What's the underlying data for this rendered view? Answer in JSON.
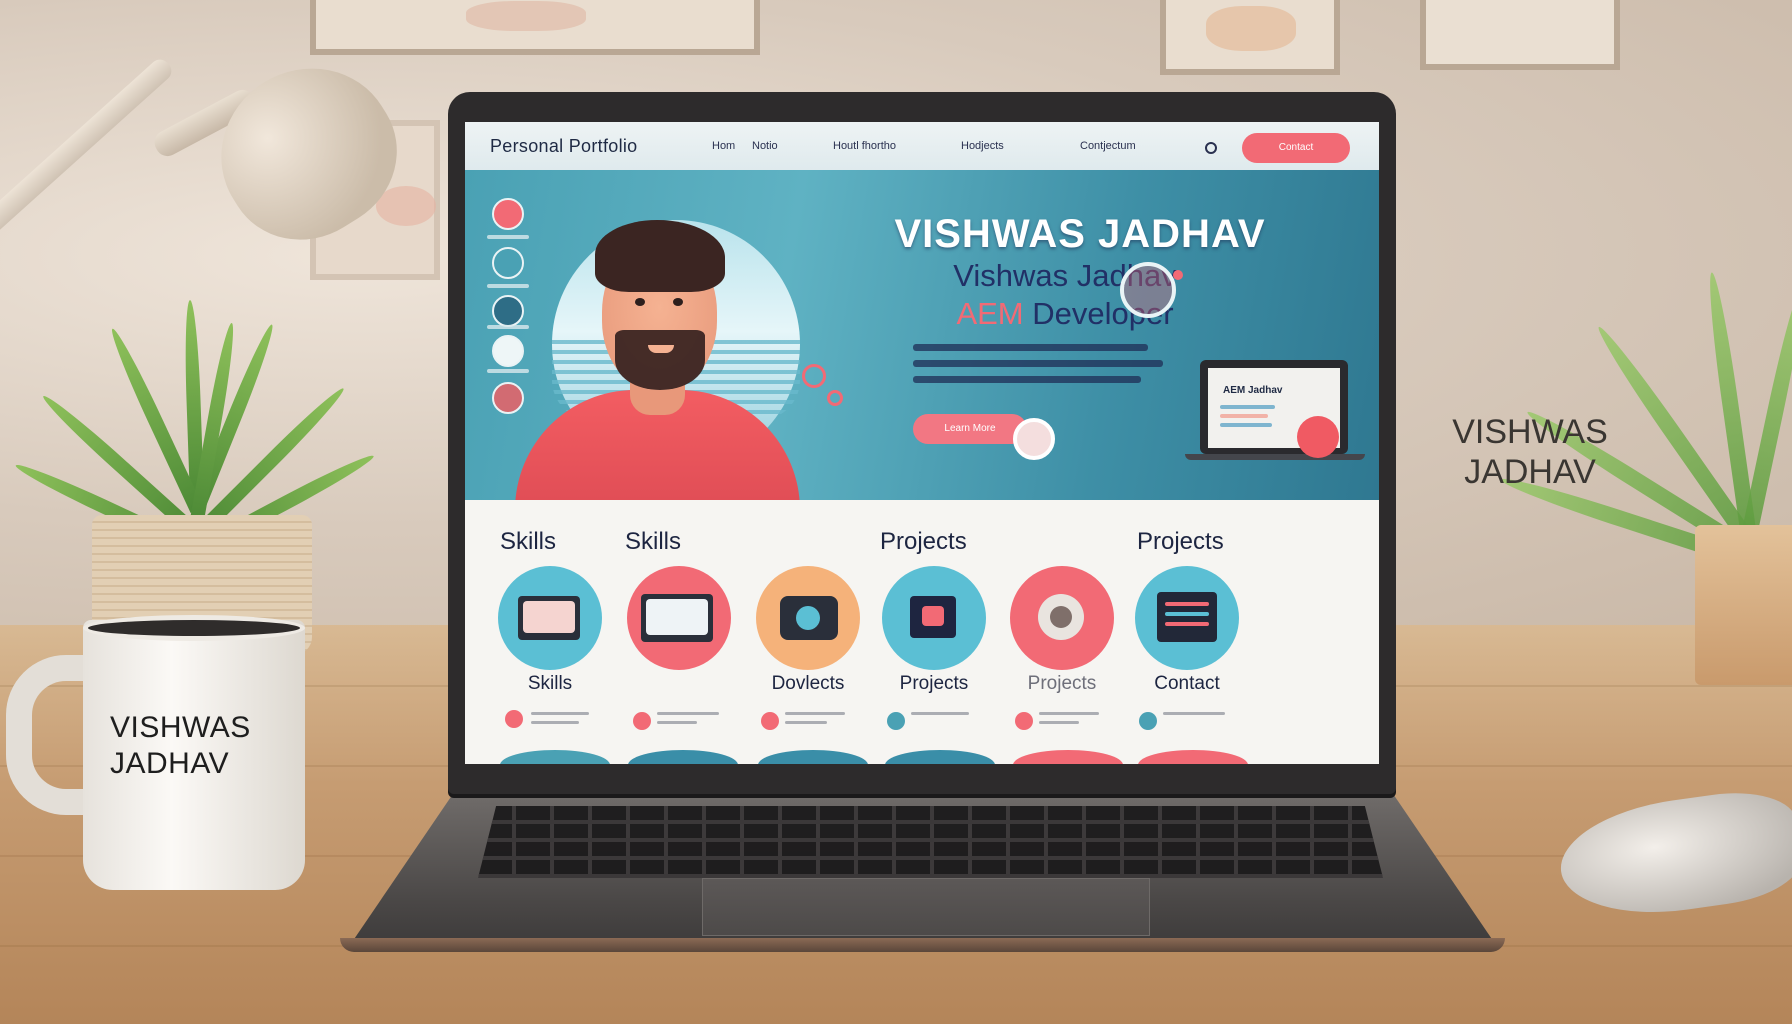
{
  "scene": {
    "mug_text": "VISHWAS JADHAV",
    "wall_text": "VISHWAS JADHAV"
  },
  "site": {
    "brand": "Personal Portfolio",
    "nav": [
      "Hom",
      "Notio",
      "Houtl fhortho",
      "Hodjects",
      "Contjectum"
    ],
    "nav_cta": "Contact",
    "hero": {
      "title": "VISHWAS JADHAV",
      "subtitle": "Vishwas Jadhav",
      "role_accent": "AEM",
      "role_rest": " Developer",
      "button": "Learn More",
      "mini_laptop_title": "AEM Jadhav"
    },
    "sections": {
      "heading_1": "Skills",
      "heading_2": "Skills",
      "heading_3": "Projects",
      "heading_4": "Projects"
    },
    "cards": [
      {
        "label": "Skills",
        "color": "#5bbfd4"
      },
      {
        "label": "",
        "color": "#f26a75"
      },
      {
        "label": "Dovlects",
        "color": "#f5b27a"
      },
      {
        "label": "Projects",
        "color": "#5bbfd4"
      },
      {
        "label": "Projects",
        "color": "#f26a75"
      },
      {
        "label": "Contact",
        "color": "#5bbfd4"
      }
    ]
  },
  "colors": {
    "accent": "#f26a75",
    "teal": "#4aa1b4",
    "navy": "#1d2541"
  }
}
